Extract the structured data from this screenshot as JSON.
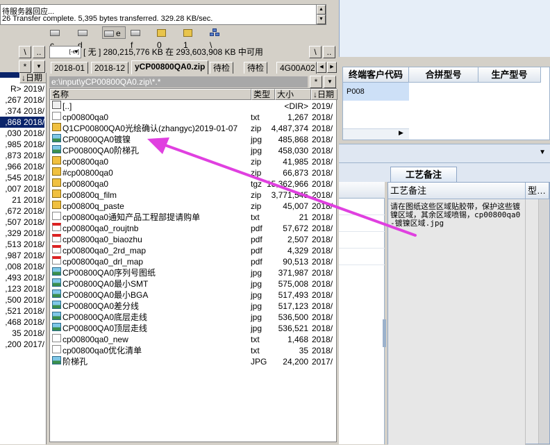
{
  "log": {
    "line1": "待服务器回应...",
    "line2": "26 Transfer complete. 5,395 bytes transferred. 329.28 KB/sec."
  },
  "drives": [
    {
      "label": "c",
      "type": "disk"
    },
    {
      "label": "d",
      "type": "disk"
    },
    {
      "label": "e",
      "type": "disk",
      "selected": true
    },
    {
      "label": "f",
      "type": "disk"
    },
    {
      "label": "0",
      "type": "folder"
    },
    {
      "label": "1",
      "type": "folder"
    },
    {
      "label": "\\",
      "type": "network"
    }
  ],
  "drive_select": "[-e-]",
  "space_info": "[ 无 ]  280,215,776 KB 在 293,603,908 KB 中可用",
  "root_btn": "\\",
  "up_btn": "..",
  "star_btn": "*",
  "left_header": {
    "root": "\\",
    "up": "..",
    "date_col": "↓日期",
    "star": "*"
  },
  "tabs": [
    "2018-01",
    "2018-12",
    "yCP00800QA0.zip",
    "待检",
    "待检",
    "4G00A02"
  ],
  "path": "e:\\input\\yCP00800QA0.zip\\*.*",
  "columns": {
    "name": "名称",
    "type": "类型",
    "size": "大小",
    "date": "↓日期"
  },
  "files": [
    {
      "name": "[..]",
      "type": "",
      "size": "<DIR>",
      "date": "2019/",
      "icon": "up"
    },
    {
      "name": "cp00800qa0",
      "type": "txt",
      "size": "1,267",
      "date": "2018/",
      "icon": "txt"
    },
    {
      "name": "Q1CP00800QA0光绘确认(zhangyc)2019-01-07",
      "type": "zip",
      "size": "4,487,374",
      "date": "2018/",
      "icon": "zip"
    },
    {
      "name": "CP00800QA0镀镍",
      "type": "jpg",
      "size": "485,868",
      "date": "2018/",
      "icon": "img"
    },
    {
      "name": "CP00800QA0阶梯孔",
      "type": "jpg",
      "size": "458,030",
      "date": "2018/",
      "icon": "img"
    },
    {
      "name": "cp00800qa0",
      "type": "zip",
      "size": "41,985",
      "date": "2018/",
      "icon": "zip"
    },
    {
      "name": "#cp00800qa0",
      "type": "zip",
      "size": "66,873",
      "date": "2018/",
      "icon": "zip"
    },
    {
      "name": "cp00800qa0",
      "type": "tgz",
      "size": "15,362,966",
      "date": "2018/",
      "icon": "zip"
    },
    {
      "name": "cp00800q_film",
      "type": "zip",
      "size": "3,771,545",
      "date": "2018/",
      "icon": "zip"
    },
    {
      "name": "cp00800q_paste",
      "type": "zip",
      "size": "45,007",
      "date": "2018/",
      "icon": "zip"
    },
    {
      "name": "cp00800qa0通知产品工程部提请购单",
      "type": "txt",
      "size": "21",
      "date": "2018/",
      "icon": "txt"
    },
    {
      "name": "cp00800qa0_roujtnb",
      "type": "pdf",
      "size": "57,672",
      "date": "2018/",
      "icon": "pdf"
    },
    {
      "name": "cp00800qa0_biaozhu",
      "type": "pdf",
      "size": "2,507",
      "date": "2018/",
      "icon": "pdf"
    },
    {
      "name": "cp00800qa0_2rd_map",
      "type": "pdf",
      "size": "4,329",
      "date": "2018/",
      "icon": "pdf"
    },
    {
      "name": "cp00800qa0_drl_map",
      "type": "pdf",
      "size": "90,513",
      "date": "2018/",
      "icon": "pdf"
    },
    {
      "name": "CP00800QA0序列号图纸",
      "type": "jpg",
      "size": "371,987",
      "date": "2018/",
      "icon": "img"
    },
    {
      "name": "CP00800QA0最小SMT",
      "type": "jpg",
      "size": "575,008",
      "date": "2018/",
      "icon": "img"
    },
    {
      "name": "CP00800QA0最小BGA",
      "type": "jpg",
      "size": "517,493",
      "date": "2018/",
      "icon": "img"
    },
    {
      "name": "CP00800QA0差分线",
      "type": "jpg",
      "size": "517,123",
      "date": "2018/",
      "icon": "img"
    },
    {
      "name": "CP00800QA0底层走线",
      "type": "jpg",
      "size": "536,500",
      "date": "2018/",
      "icon": "img"
    },
    {
      "name": "CP00800QA0顶层走线",
      "type": "jpg",
      "size": "536,521",
      "date": "2018/",
      "icon": "img"
    },
    {
      "name": "cp00800qa0_new",
      "type": "txt",
      "size": "1,468",
      "date": "2018/",
      "icon": "txt"
    },
    {
      "name": "cp00800qa0优化清单",
      "type": "txt",
      "size": "35",
      "date": "2018/",
      "icon": "txt"
    },
    {
      "name": "阶梯孔",
      "type": "JPG",
      "size": "24,200",
      "date": "2017/",
      "icon": "img"
    }
  ],
  "left_pane_rows": [
    "R>  2019/",
    ",267  2018/",
    ",374  2018/",
    ",868  2018/",
    ",030  2018/",
    ",985  2018/",
    ",873  2018/",
    ",966  2018/",
    ",545  2018/",
    ",007  2018/",
    "21  2018/",
    ",672  2018/",
    ",507  2018/",
    ",329  2018/",
    ",513  2018/",
    ",987  2018/",
    ",008  2018/",
    ",493  2018/",
    ",123  2018/",
    ",500  2018/",
    ",521  2018/",
    ",468  2018/",
    "35  2018/",
    ",200  2017/"
  ],
  "right_grid": {
    "col1": "终端客户代码",
    "col2": "合拼型号",
    "col3": "生产型号",
    "row1_col1": "P008"
  },
  "process_notes": {
    "tab_label": "工艺备注",
    "column_label": "工艺备注",
    "type_col": "型…",
    "note": "请在图纸这些区域贴胶带，保护这些镀镍区域，其余区域喷锡，cp00800qa0-镀镍区域.jpg"
  },
  "annotation_color": "#e040e0"
}
